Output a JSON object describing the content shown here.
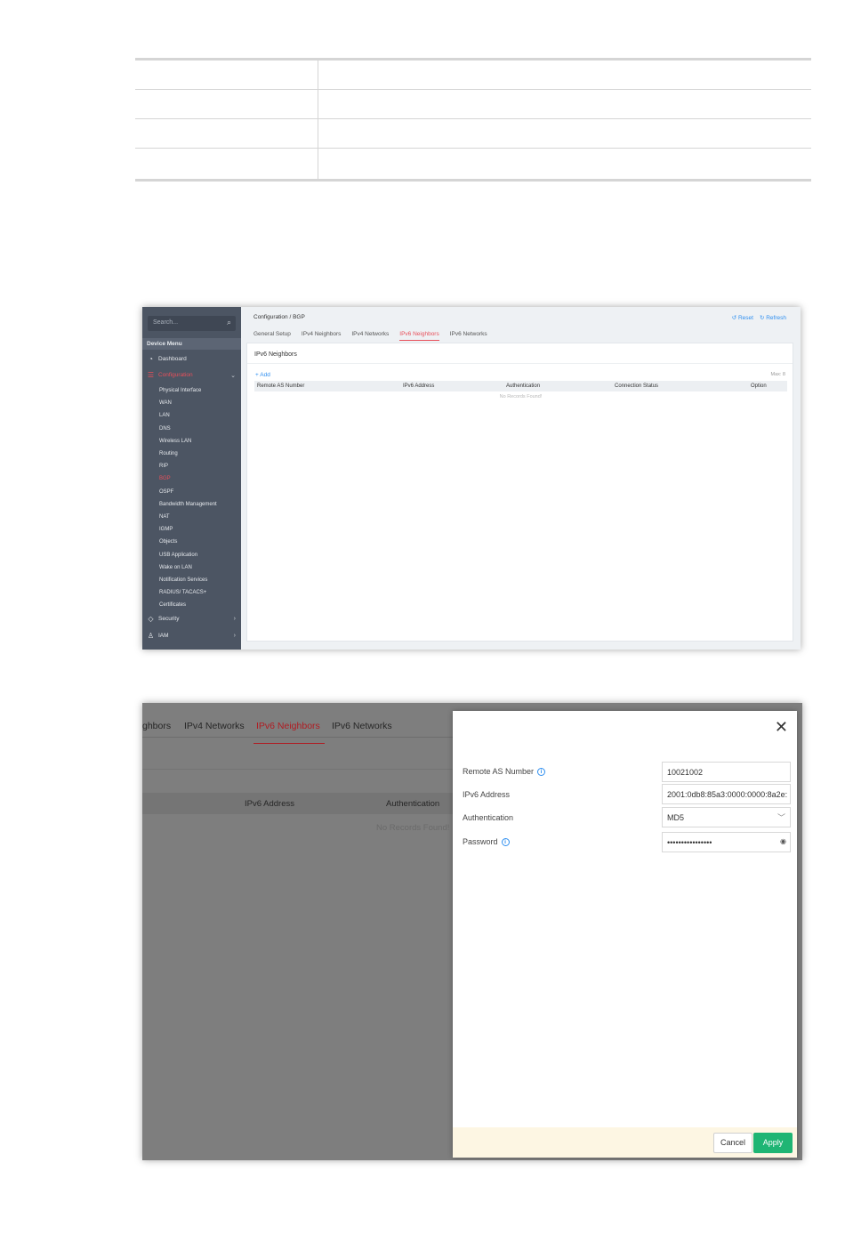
{
  "shot1": {
    "search_placeholder": "Search...",
    "device_menu": "Device Menu",
    "nav": {
      "dashboard": "Dashboard",
      "configuration": "Configuration",
      "security": "Security",
      "iam": "IAM"
    },
    "submenu": [
      "Physical Interface",
      "WAN",
      "LAN",
      "DNS",
      "Wireless LAN",
      "Routing",
      "RIP",
      "BGP",
      "OSPF",
      "Bandwidth Management",
      "NAT",
      "IGMP",
      "Objects",
      "USB Application",
      "Wake on LAN",
      "Notification Services",
      "RADIUS/ TACACS+",
      "Certificates"
    ],
    "active_submenu": "BGP",
    "breadcrumb": "Configuration / BGP",
    "reset": "Reset",
    "refresh": "Refresh",
    "tabs": [
      "General Setup",
      "IPv4 Neighbors",
      "IPv4 Networks",
      "IPv6 Neighbors",
      "IPv6 Networks"
    ],
    "active_tab": "IPv6 Neighbors",
    "panel_title": "IPv6 Neighbors",
    "add": "+ Add",
    "max": "Max: 8",
    "columns": [
      "Remote AS Number",
      "IPv6 Address",
      "Authentication",
      "Connection Status",
      "Option"
    ],
    "empty": "No Records Found!"
  },
  "shot2": {
    "tabs": [
      "ghbors",
      "IPv4 Networks",
      "IPv6 Neighbors",
      "IPv6 Networks"
    ],
    "active_tab": "IPv6 Neighbors",
    "columns": [
      "IPv6 Address",
      "Authentication"
    ],
    "empty": "No Records Found!",
    "modal": {
      "remote_as_label": "Remote AS Number",
      "remote_as_value": "10021002",
      "ipv6_label": "IPv6 Address",
      "ipv6_value": "2001:0db8:85a3:0000:0000:8a2e:",
      "auth_label": "Authentication",
      "auth_value": "MD5",
      "password_label": "Password",
      "password_value": "••••••••••••••••",
      "cancel": "Cancel",
      "apply": "Apply"
    }
  },
  "colors": {
    "accent_red": "#e8505b",
    "link_blue": "#2f8ff0",
    "apply_green": "#1fb574",
    "sidebar": "#4c5563"
  }
}
